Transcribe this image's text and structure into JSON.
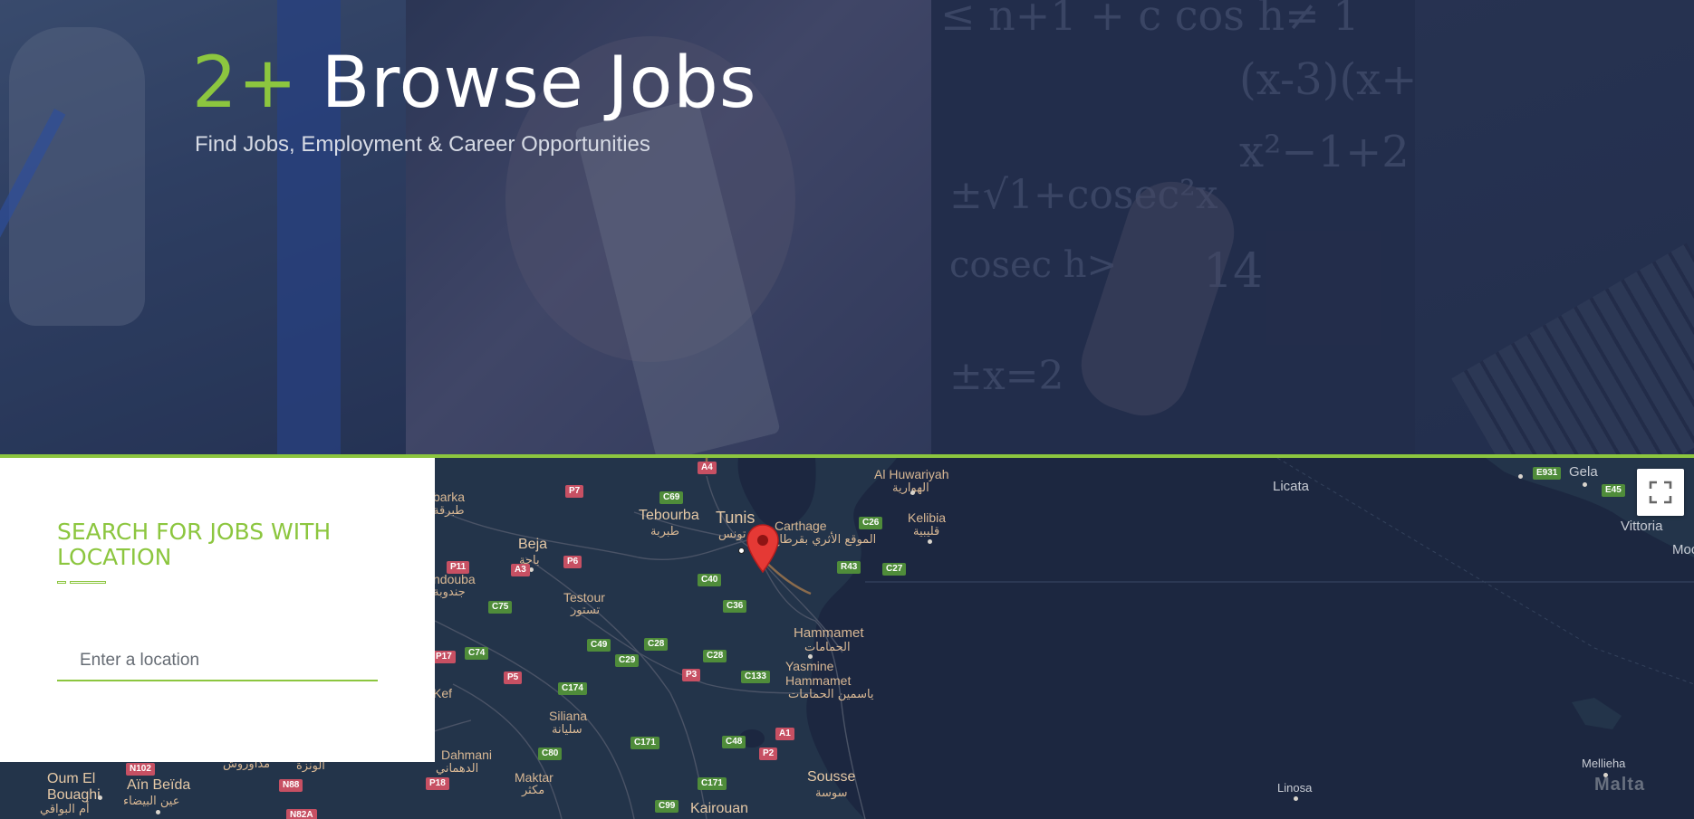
{
  "hero": {
    "count": "2+",
    "title": "Browse Jobs",
    "subtitle": "Find Jobs, Employment & Career Opportunities"
  },
  "search": {
    "heading": "SEARCH FOR JOBS WITH LOCATION",
    "location_placeholder": "Enter a location"
  },
  "map": {
    "marker_color": "#e53935",
    "accent_color": "#8cc63f",
    "fullscreen_icon": "fullscreen-icon",
    "places": [
      {
        "name": "Tunis",
        "ar": "تونس"
      },
      {
        "name": "Carthage",
        "ar": "الموقع الأثري بقرطاج"
      },
      {
        "name": "Tebourba",
        "ar": "طبربة"
      },
      {
        "name": "Beja",
        "ar": "باجة"
      },
      {
        "name": "Testour",
        "ar": "تستور"
      },
      {
        "name": "Al Huwariyah",
        "ar": "الهوارية"
      },
      {
        "name": "Kelibia",
        "ar": "قليبية"
      },
      {
        "name": "Hammamet",
        "ar": "الحمامات"
      },
      {
        "name": "Yasmine Hammamet",
        "ar": "ياسمين الحمامات"
      },
      {
        "name": "Siliana",
        "ar": "سليانة"
      },
      {
        "name": "Sousse",
        "ar": "سوسة"
      },
      {
        "name": "Kairouan",
        "ar": ""
      },
      {
        "name": "Maktar",
        "ar": "مكثر"
      },
      {
        "name": "Oum El Bouaghi",
        "ar": "أم البواقي"
      },
      {
        "name": "Aïn Beïda",
        "ar": "عين البيضاء"
      },
      {
        "name": "Dahmani",
        "ar": "الدهماني"
      },
      {
        "name": "Licata",
        "ar": ""
      },
      {
        "name": "Gela",
        "ar": ""
      },
      {
        "name": "Vittoria",
        "ar": ""
      },
      {
        "name": "Mellieha",
        "ar": ""
      },
      {
        "name": "Linosa",
        "ar": ""
      },
      {
        "name": "Malta",
        "ar": ""
      },
      {
        "name": "ndouba",
        "ar": "جندوبة"
      },
      {
        "name": "barka",
        "ar": "طبرقة"
      },
      {
        "name": "Kef",
        "ar": ""
      },
      {
        "name": "Moc",
        "ar": ""
      }
    ],
    "road_shields": [
      "A4",
      "P7",
      "C69",
      "C26",
      "P11",
      "A3",
      "P6",
      "C40",
      "R43",
      "C27",
      "C75",
      "C36",
      "C49",
      "C28",
      "C74",
      "P17",
      "C29",
      "C28",
      "P5",
      "C174",
      "P3",
      "C133",
      "C80",
      "C171",
      "C48",
      "A1",
      "P2",
      "N102",
      "N88",
      "P18",
      "C171",
      "C99",
      "N82A",
      "E931",
      "E45"
    ],
    "misc_labels": [
      "مداوروش",
      "الونزة"
    ]
  }
}
